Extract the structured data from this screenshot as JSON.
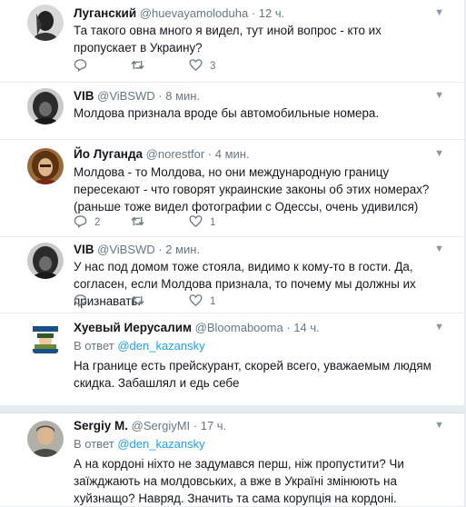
{
  "tweets": [
    {
      "name": "Луганский",
      "handle": "@huevayamoloduha",
      "time": "· 12 ч.",
      "text": "Та такого  овна много я видел, тут иной вопрос - кто их пропускает в Украину?",
      "replies": "",
      "retweets": "",
      "likes": "3"
    },
    {
      "name": "VIB",
      "handle": "@ViBSWD",
      "time": "· 8 мин.",
      "text": "Молдова признала вроде бы автомобильные номера."
    },
    {
      "name": "Йо Луганда",
      "handle": "@norestfor",
      "time": "· 4 мин.",
      "text": "Молдова - то Молдова, но они международную границу пересекают - что говорят украинские законы об этих номерах? (раньше тоже видел фотографии с Одессы, очень удивился)",
      "replies": "2",
      "retweets": "",
      "likes": "1"
    },
    {
      "name": "VIB",
      "handle": "@ViBSWD",
      "time": "· 2 мин.",
      "text": "У нас под домом тоже стояла, видимо к кому-то в гости. Да, согласен, если Молдова признала, то почему мы должны их признавать.",
      "replies": "",
      "retweets": "",
      "likes": "1"
    },
    {
      "name": "Хуевый Иерусалим",
      "handle": "@Bloomabooma",
      "time": "· 14 ч.",
      "reply_prefix": "В ответ",
      "reply_mention": "@den_kazansky",
      "text": "На границе есть прейскурант, скорей всего, уважаемым людям скидка. Забашлял и едь себе"
    },
    {
      "name": "Sergiy M.",
      "handle": "@SergiyMI",
      "time": "· 17 ч.",
      "reply_prefix": "В ответ",
      "reply_mention": "@den_kazansky",
      "text": "А на кордоні ніхто не задумався перш, ніж пропустити? Чи заїжджають на молдовських, а вже в Україні змінюють на хуйзнащо? Навряд. Значить та сама корупція на кордоні."
    }
  ],
  "icons": {
    "reply": "reply-icon",
    "retweet": "retweet-icon",
    "like": "heart-icon",
    "menu": "chevron-down-icon"
  },
  "colors": {
    "text": "#14171a",
    "secondary": "#657786",
    "link": "#1da1f2",
    "divider": "#e6ecf0"
  }
}
